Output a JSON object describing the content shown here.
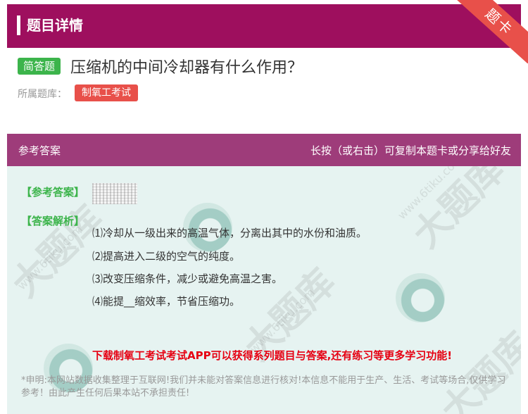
{
  "header": {
    "title": "题目详情",
    "ribbon": "题卡"
  },
  "question": {
    "type_badge": "简答题",
    "text": "压缩机的中间冷却器有什么作用？",
    "bank_label": "所属题库：",
    "bank_name": "制氧工考试"
  },
  "answer": {
    "section_label": "参考答案",
    "copy_hint": "长按（或右击）可复制本题卡或分享给好友",
    "answer_tag": "【参考答案】",
    "analysis_tag": "【答案解析】",
    "lines": [
      "⑴冷却从一级出来的高温气体，分离出其中的水份和油质。",
      "⑵提高进入二级的空气的纯度。",
      "⑶改变压缩条件，减少或避免高温之害。",
      "⑷能提__缩效率，节省压缩功。"
    ],
    "promo": "下载制氧工考试考试APP可以获得系列题目与答案,还有练习等更多学习功能!",
    "disclaimer": "*申明:本网站数据收集整理于互联网!我们并未能对答案信息进行核对!本信息不能用于生产、生活、考试等场合,仅供学习参考！由此产生任何后果本站不承担责任!"
  },
  "colors": {
    "header_bg": "#9e0f5e",
    "answer_header_bg": "#9e3c7a",
    "answer_body_bg": "#e6f3f1",
    "badge_green": "#3cb44b",
    "tag_red": "#e8504a",
    "promo_red": "#e60012"
  }
}
